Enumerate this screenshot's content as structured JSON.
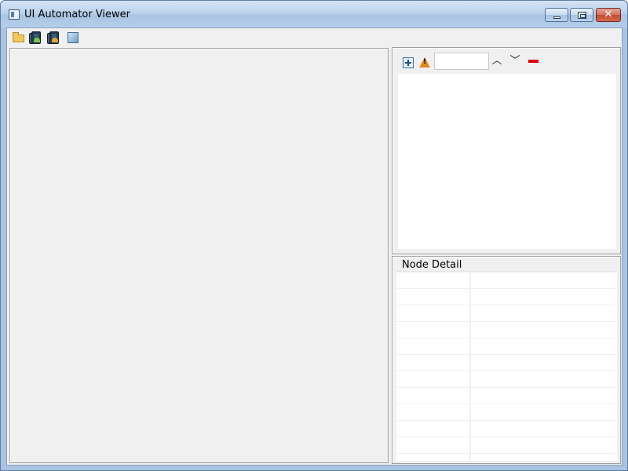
{
  "window": {
    "title": "UI Automator Viewer",
    "controls": {
      "minimize_icon": "minimize-icon",
      "maximize_icon": "maximize-icon",
      "close_icon": "close-icon",
      "close_glyph": "✕"
    },
    "colors": {
      "titlebar": "#bcd3ec",
      "close_button": "#c24a33",
      "client_background": "#f0f0f0"
    }
  },
  "toolbar": {
    "buttons": [
      {
        "icon": "open-folder-icon"
      },
      {
        "icon": "device-screenshot-icon"
      },
      {
        "icon": "device-screenshot-compressed-icon"
      },
      {
        "icon": "save-icon"
      }
    ]
  },
  "hierarchy": {
    "tools": {
      "expand_all_icon": "expand-all-icon",
      "warning_icon": "warning-icon",
      "warning_mark": "!",
      "search_value": "",
      "prev_glyph": "︿",
      "next_glyph": "﹀",
      "clear_icon": "clear-search-icon"
    }
  },
  "node_detail": {
    "title": "Node Detail",
    "rows": [
      "",
      "",
      "",
      "",
      "",
      "",
      "",
      "",
      "",
      "",
      ""
    ]
  }
}
